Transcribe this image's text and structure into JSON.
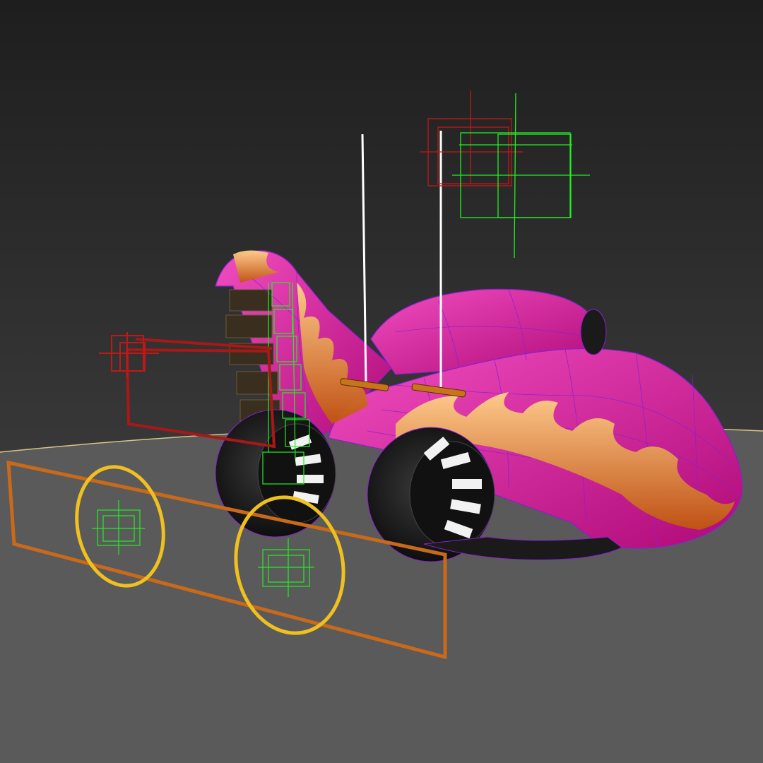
{
  "viewport": {
    "background_top": "#1e1e1e",
    "background_bottom": "#4a4a4a",
    "ground_color": "#5a5a5a",
    "horizon_line_color": "#d8c48a"
  },
  "model": {
    "body_color": "#e0139a",
    "body_highlight": "#f04dc0",
    "wire_color": "#8a1fd0",
    "flame_color": "#e07a1a",
    "flame_core": "#ffd28a",
    "engine_color": "#1a1a1a"
  },
  "rig": {
    "green_helper": "#22ee22",
    "red_helper": "#c01818",
    "orange_frame": "#c86a1a",
    "yellow_ring": "#f0c020",
    "white_line": "#ffffff",
    "bar_color": "#c8741a"
  },
  "icons": [
    "point-helper-icon",
    "ring-control-icon",
    "frame-control-icon"
  ]
}
